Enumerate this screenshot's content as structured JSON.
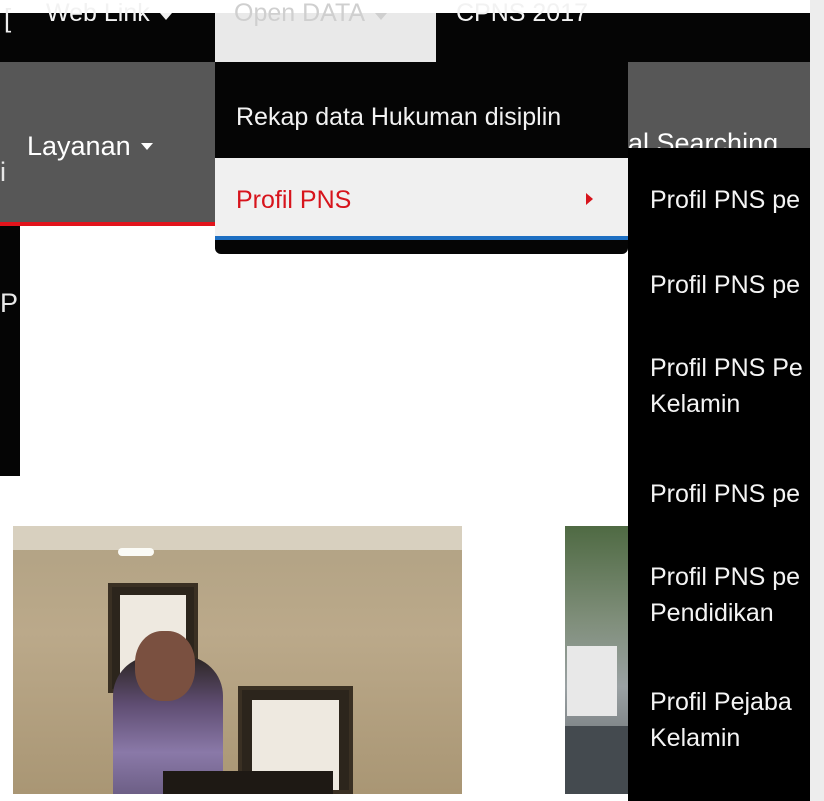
{
  "top_nav": {
    "partial_left": "[",
    "web_link": "Web Link",
    "open_data": "Open DATA",
    "cpns": "CPNS 2017"
  },
  "main_nav": {
    "left_partial_1": "i",
    "left_partial_2": "P",
    "layanan": "Layanan",
    "searching_partial": "al Searching"
  },
  "dropdown": {
    "items": [
      {
        "label": "Rekap data Hukuman disiplin"
      },
      {
        "label": "Profil PNS"
      }
    ]
  },
  "submenu": {
    "items": [
      {
        "line1": "Profil PNS pe",
        "line2": ""
      },
      {
        "line1": "Profil PNS pe",
        "line2": ""
      },
      {
        "line1": "Profil PNS Pe",
        "line2": "Kelamin"
      },
      {
        "line1": "Profil PNS pe",
        "line2": ""
      },
      {
        "line1": "Profil PNS pe",
        "line2": "Pendidikan"
      },
      {
        "line1": "Profil Pejaba",
        "line2": "Kelamin"
      }
    ]
  },
  "colors": {
    "accent_red": "#d7141c",
    "nav_black": "#050505",
    "nav_gray": "#575757",
    "active_underline": "#1d6fc2"
  }
}
